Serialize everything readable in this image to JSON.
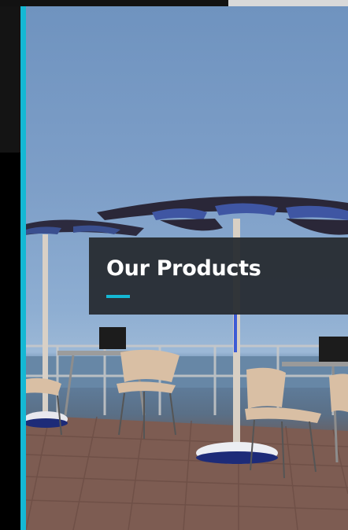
{
  "section": {
    "title": "Our Products"
  },
  "colors": {
    "accent": "#14b8d4",
    "card_background": "#262b30",
    "title_text": "#ffffff"
  },
  "hero_image": {
    "icon": "solar-umbrella-patio-photo"
  }
}
